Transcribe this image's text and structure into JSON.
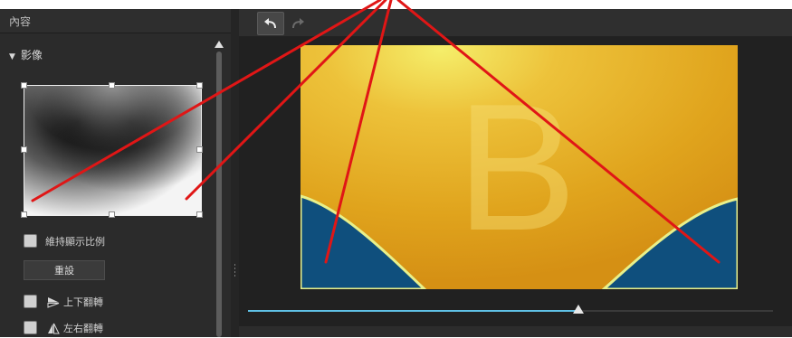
{
  "panel": {
    "header_title": "內容",
    "section_title": "影像",
    "keep_ratio_label": "維持顯示比例",
    "reset_label": "重設",
    "flip_vertical_label": "上下翻轉",
    "flip_horizontal_label": "左右翻轉"
  },
  "toolbar": {
    "undo_icon": "undo-icon",
    "redo_icon": "redo-icon"
  },
  "preview": {
    "watermark_letter": "B"
  },
  "timeline": {
    "position_fraction": 0.63
  },
  "colors": {
    "annotation_line": "#e01616",
    "slider_accent": "#5fc1e6",
    "preview_gold": "#e8b020",
    "preview_blue": "#0f4f7d"
  }
}
